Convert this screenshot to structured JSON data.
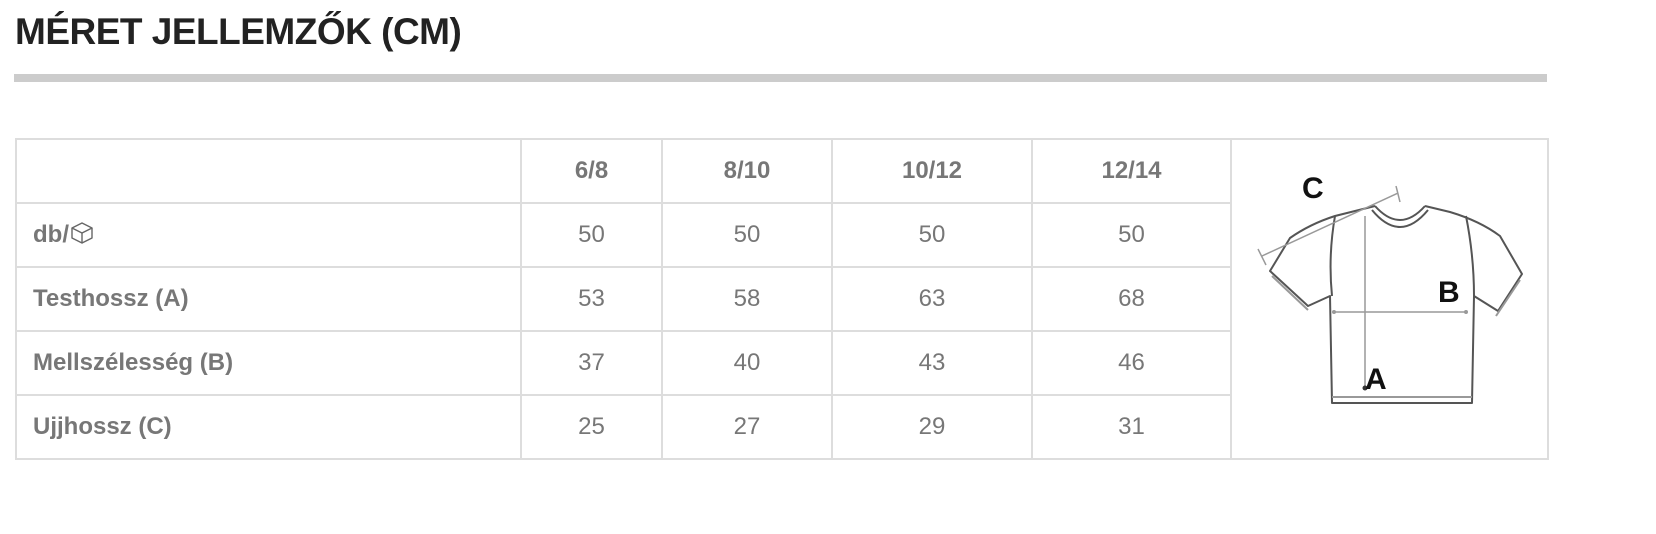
{
  "title": "MÉRET JELLEMZŐK (CM)",
  "columns": [
    "6/8",
    "8/10",
    "10/12",
    "12/14"
  ],
  "rows": [
    {
      "label": "db/",
      "icon": "box-icon",
      "values": [
        "50",
        "50",
        "50",
        "50"
      ]
    },
    {
      "label": "Testhossz (A)",
      "values": [
        "53",
        "58",
        "63",
        "68"
      ]
    },
    {
      "label": "Mellszélesség (B)",
      "values": [
        "37",
        "40",
        "43",
        "46"
      ]
    },
    {
      "label": "Ujjhossz (C)",
      "values": [
        "25",
        "27",
        "29",
        "31"
      ]
    }
  ],
  "diagram": {
    "icon": "tshirt-measurement-diagram",
    "labels": {
      "a": "A",
      "b": "B",
      "c": "C"
    }
  },
  "colors": {
    "title": "#222222",
    "rule": "#cccccc",
    "border": "#dddddd",
    "text": "#777777"
  }
}
